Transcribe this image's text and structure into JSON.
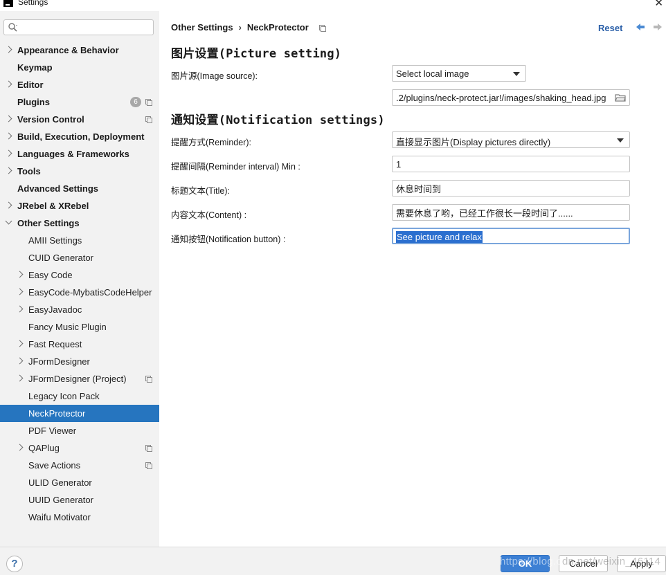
{
  "window": {
    "title": "Settings",
    "close_glyph": "✕"
  },
  "search": {
    "placeholder": "",
    "value": ""
  },
  "sidebar": {
    "items": [
      {
        "label": "Appearance & Behavior",
        "level": 1,
        "chevron": "closed"
      },
      {
        "label": "Keymap",
        "level": 1,
        "chevron": "none"
      },
      {
        "label": "Editor",
        "level": 1,
        "chevron": "closed"
      },
      {
        "label": "Plugins",
        "level": 1,
        "chevron": "none",
        "badge": "6",
        "project_icon": true
      },
      {
        "label": "Version Control",
        "level": 1,
        "chevron": "closed",
        "project_icon": true
      },
      {
        "label": "Build, Execution, Deployment",
        "level": 1,
        "chevron": "closed"
      },
      {
        "label": "Languages & Frameworks",
        "level": 1,
        "chevron": "closed"
      },
      {
        "label": "Tools",
        "level": 1,
        "chevron": "closed"
      },
      {
        "label": "Advanced Settings",
        "level": 1,
        "chevron": "none"
      },
      {
        "label": "JRebel & XRebel",
        "level": 1,
        "chevron": "closed"
      },
      {
        "label": "Other Settings",
        "level": 1,
        "chevron": "open"
      },
      {
        "label": "AMII Settings",
        "level": 2,
        "chevron": "none"
      },
      {
        "label": "CUID Generator",
        "level": 2,
        "chevron": "none"
      },
      {
        "label": "Easy Code",
        "level": 2,
        "chevron": "closed"
      },
      {
        "label": "EasyCode-MybatisCodeHelper",
        "level": 2,
        "chevron": "closed"
      },
      {
        "label": "EasyJavadoc",
        "level": 2,
        "chevron": "closed"
      },
      {
        "label": "Fancy Music Plugin",
        "level": 2,
        "chevron": "none"
      },
      {
        "label": "Fast Request",
        "level": 2,
        "chevron": "closed"
      },
      {
        "label": "JFormDesigner",
        "level": 2,
        "chevron": "closed"
      },
      {
        "label": "JFormDesigner (Project)",
        "level": 2,
        "chevron": "closed",
        "project_icon": true
      },
      {
        "label": "Legacy Icon Pack",
        "level": 2,
        "chevron": "none"
      },
      {
        "label": "NeckProtector",
        "level": 2,
        "chevron": "none",
        "selected": true
      },
      {
        "label": "PDF Viewer",
        "level": 2,
        "chevron": "none"
      },
      {
        "label": "QAPlug",
        "level": 2,
        "chevron": "closed",
        "project_icon": true
      },
      {
        "label": "Save Actions",
        "level": 2,
        "chevron": "none",
        "project_icon": true
      },
      {
        "label": "ULID Generator",
        "level": 2,
        "chevron": "none"
      },
      {
        "label": "UUID Generator",
        "level": 2,
        "chevron": "none"
      },
      {
        "label": "Waifu Motivator",
        "level": 2,
        "chevron": "none"
      }
    ]
  },
  "header": {
    "breadcrumb_parent": "Other Settings",
    "breadcrumb_separator": "›",
    "breadcrumb_current": "NeckProtector",
    "reset_label": "Reset"
  },
  "picture_section": {
    "title": "图片设置(Picture setting)",
    "image_source_label": "图片源(Image source):",
    "image_source_value": "Select local image",
    "image_path_value": ".2/plugins/neck-protect.jar!/images/shaking_head.jpg"
  },
  "notification_section": {
    "title": "通知设置(Notification settings)",
    "reminder_label": "提醒方式(Reminder):",
    "reminder_value": "直接显示图片(Display pictures directly)",
    "interval_label": "提醒间隔(Reminder interval) Min :",
    "interval_value": "1",
    "title_label": "标题文本(Title):",
    "title_value": "休息时间到",
    "content_label": "内容文本(Content) :",
    "content_value": "需要休息了哟，已经工作很长一段时间了......",
    "button_label": "通知按钮(Notification button) :",
    "button_value": "See picture and relax"
  },
  "footer": {
    "help_label": "?",
    "ok_label": "OK",
    "cancel_label": "Cancel",
    "apply_label": "Apply",
    "watermark_left": "https://blog.cs",
    "watermark_right": "dn.net/weixin_46114"
  },
  "colors": {
    "selection": "#2675bf",
    "link": "#2a5fa8",
    "sidebar_bg": "#f2f2f2",
    "primary_button": "#3d80d4"
  }
}
